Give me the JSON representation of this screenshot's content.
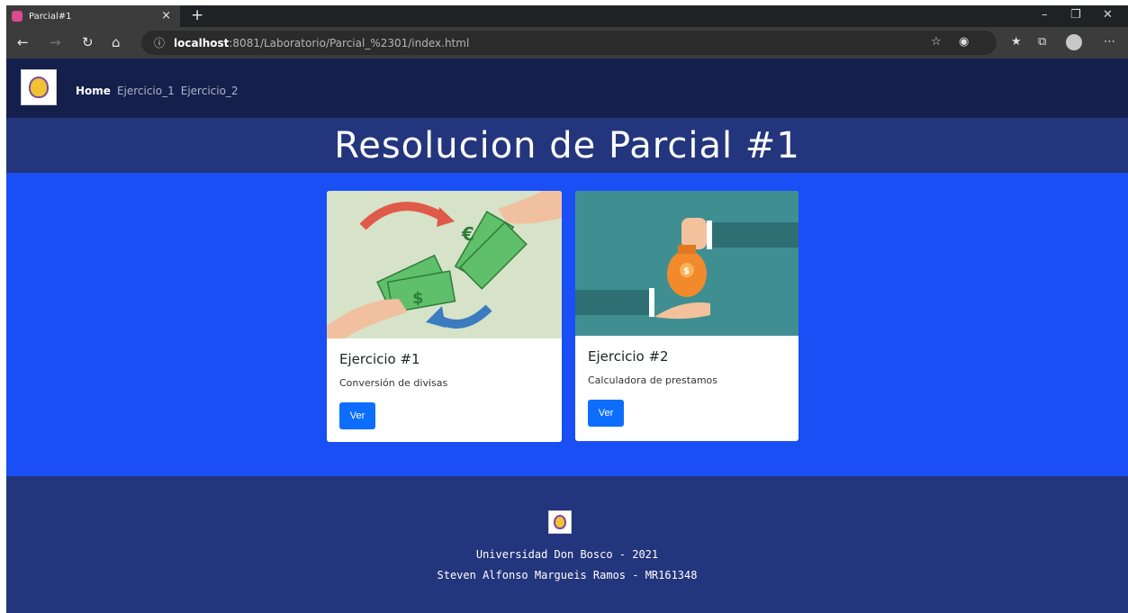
{
  "browser": {
    "tab_title": "Parcial#1",
    "tab_close": "×",
    "new_tab": "+",
    "url_host": "localhost",
    "url_rest": ":8081/Laboratorio/Parcial_%2301/index.html",
    "icons": [
      "back-icon",
      "forward-icon",
      "refresh-icon",
      "home-icon",
      "info-icon",
      "read-aloud-icon",
      "tracking-icon",
      "favorites-icon",
      "collections-icon",
      "profile-icon",
      "more-icon"
    ]
  },
  "navbar": {
    "links": [
      {
        "label": "Home",
        "active": true
      },
      {
        "label": "Ejercicio_1",
        "active": false
      },
      {
        "label": "Ejercicio_2",
        "active": false
      }
    ]
  },
  "hero": {
    "title": "Resolucion de Parcial #1"
  },
  "cards": [
    {
      "title": "Ejercicio #1",
      "text": "Conversión de divisas",
      "button": "Ver"
    },
    {
      "title": "Ejercicio #2",
      "text": "Calculadora de prestamos",
      "button": "Ver"
    }
  ],
  "footer": {
    "line1": "Universidad Don Bosco - 2021",
    "line2": "Steven Alfonso Margueis Ramos - MR161348"
  },
  "colors": {
    "navbar": "#141f4b",
    "hero": "#23357c",
    "content": "#1a4ff5",
    "button": "#0d6efd"
  }
}
